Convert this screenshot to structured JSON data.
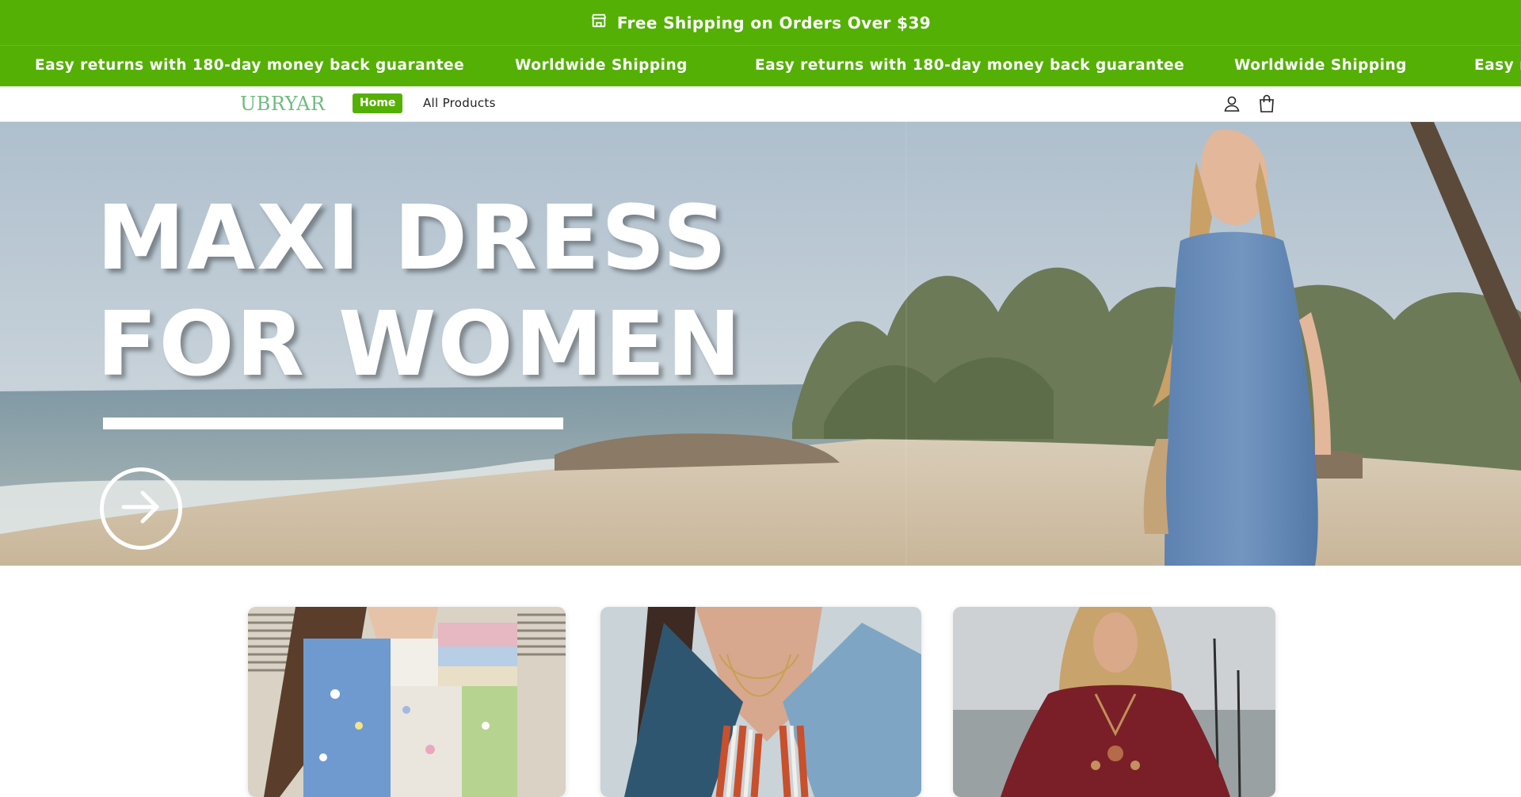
{
  "announcement": {
    "icon": "store-icon",
    "text": "Free Shipping on Orders Over $39"
  },
  "marquee": {
    "items": [
      "Easy returns with 180-day money back guarantee",
      "Worldwide Shipping",
      "Easy returns with 180-day money back guarantee",
      "Worldwide Shipping",
      "Easy r"
    ]
  },
  "header": {
    "logo": "UBRYAR",
    "nav": [
      {
        "label": "Home",
        "active": true
      },
      {
        "label": "All Products",
        "active": false
      }
    ],
    "icons": [
      "account-icon",
      "cart-icon"
    ]
  },
  "hero": {
    "title_line1": "MAXI DRESS",
    "title_line2": "FOR WOMEN",
    "cta_icon": "arrow-right-icon"
  },
  "products": [
    {
      "image": "patchwork-blouse-photo"
    },
    {
      "image": "striped-shirt-photo"
    },
    {
      "image": "boho-dress-photo"
    }
  ],
  "colors": {
    "brand_green": "#54b004",
    "logo_green": "#6dbb7e"
  }
}
